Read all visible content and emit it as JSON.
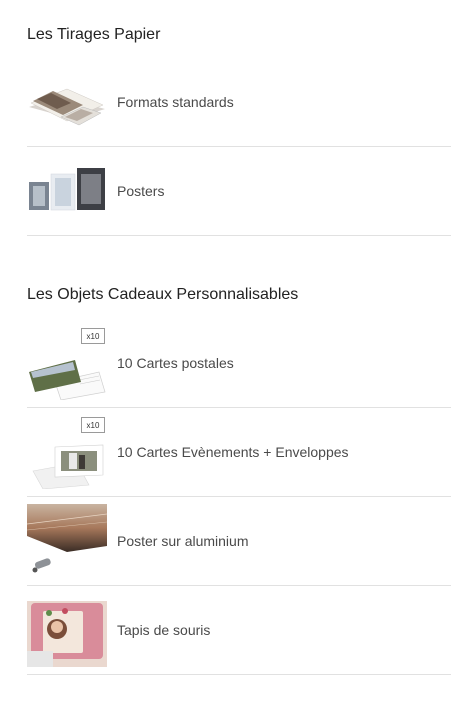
{
  "sections": [
    {
      "title": "Les Tirages Papier",
      "items": [
        {
          "label": "Formats standards",
          "icon": "photo-prints-icon"
        },
        {
          "label": "Posters",
          "icon": "posters-icon"
        }
      ]
    },
    {
      "title": "Les Objets Cadeaux Personnalisables",
      "items": [
        {
          "label": "10 Cartes postales",
          "icon": "postcards-icon",
          "badge": "x10"
        },
        {
          "label": "10 Cartes Evènements + Enveloppes",
          "icon": "event-cards-icon",
          "badge": "x10"
        },
        {
          "label": "Poster sur aluminium",
          "icon": "aluminium-poster-icon"
        },
        {
          "label": "Tapis de souris",
          "icon": "mousepad-icon"
        }
      ]
    }
  ],
  "colors": {
    "divider": "#e1e1e1",
    "title": "#222222",
    "label": "#4a4a4a"
  }
}
